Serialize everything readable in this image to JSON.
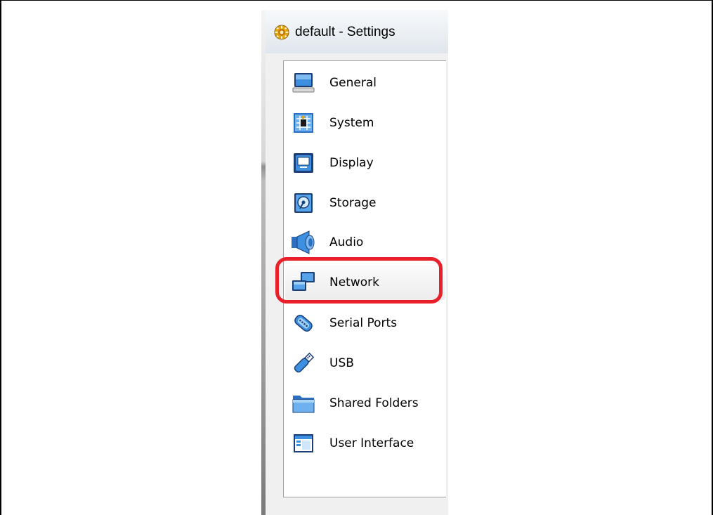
{
  "window": {
    "title": "default - Settings"
  },
  "sidebar": {
    "selected_index": 5,
    "items": [
      {
        "label": "General",
        "icon": "monitor-icon"
      },
      {
        "label": "System",
        "icon": "chip-icon"
      },
      {
        "label": "Display",
        "icon": "display-icon"
      },
      {
        "label": "Storage",
        "icon": "disk-icon"
      },
      {
        "label": "Audio",
        "icon": "speaker-icon"
      },
      {
        "label": "Network",
        "icon": "network-icon"
      },
      {
        "label": "Serial Ports",
        "icon": "serial-port-icon"
      },
      {
        "label": "USB",
        "icon": "usb-icon"
      },
      {
        "label": "Shared Folders",
        "icon": "folder-icon"
      },
      {
        "label": "User Interface",
        "icon": "window-icon"
      }
    ]
  },
  "colors": {
    "highlight_ring": "#e8202a",
    "icon_blue": "#2f7fd6"
  }
}
